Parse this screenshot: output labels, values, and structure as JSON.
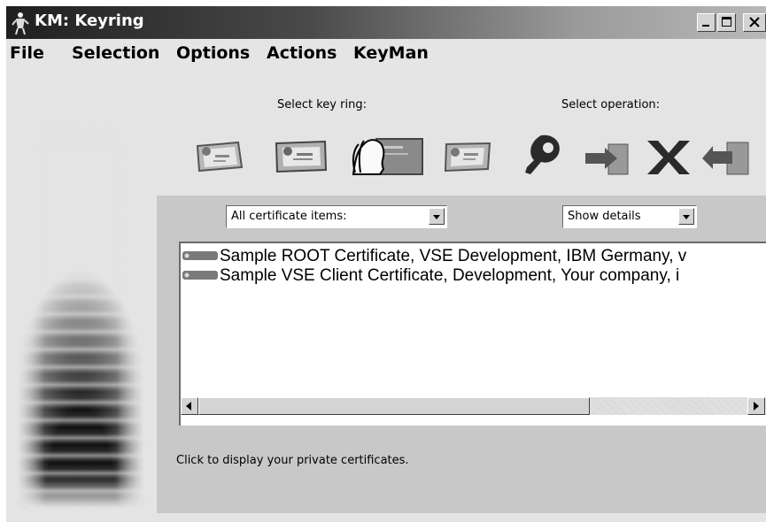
{
  "window": {
    "title": "KM: Keyring"
  },
  "menu": [
    "File",
    "Selection",
    "Options",
    "Actions",
    "KeyMan"
  ],
  "labels": {
    "select_key_ring": "Select key ring:",
    "select_operation": "Select operation:"
  },
  "filters": {
    "item_filter": "All certificate items:",
    "details": "Show details"
  },
  "certificates": [
    {
      "text": "Sample ROOT Certificate, VSE Development, IBM Germany, v"
    },
    {
      "text": "Sample VSE Client Certificate, Development, Your company, i"
    }
  ],
  "status": "Click to display your private certificates.",
  "icons": {
    "key_rings": [
      "certificate-card-icon",
      "certificate-card-icon",
      "private-certificate-person-icon",
      "certificate-card-icon"
    ],
    "operations": [
      "key-icon",
      "import-arrow-icon",
      "delete-x-icon",
      "export-arrow-icon"
    ]
  }
}
